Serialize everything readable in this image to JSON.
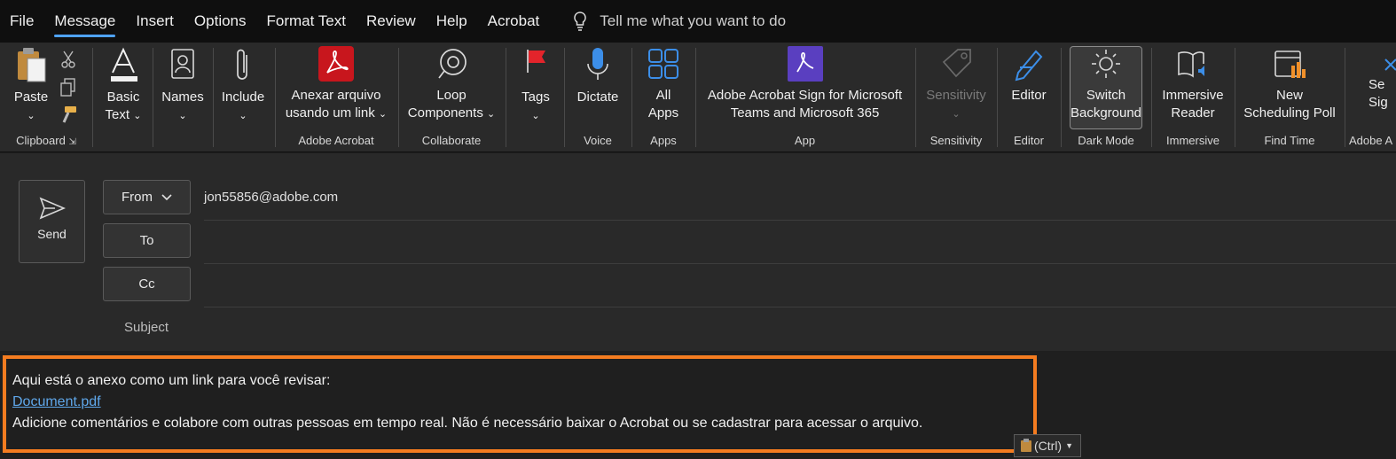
{
  "menu": {
    "items": [
      "File",
      "Message",
      "Insert",
      "Options",
      "Format Text",
      "Review",
      "Help",
      "Acrobat"
    ],
    "active": "Message",
    "tell_me": "Tell me what you want to do"
  },
  "ribbon": {
    "clipboard": {
      "paste": "Paste",
      "label": "Clipboard"
    },
    "basic_text": {
      "line1": "Basic",
      "line2": "Text"
    },
    "names": "Names",
    "include": "Include",
    "adobe_acrobat": {
      "line1": "Anexar arquivo",
      "line2": "usando um link",
      "label": "Adobe Acrobat"
    },
    "collaborate": {
      "line1": "Loop",
      "line2": "Components",
      "label": "Collaborate"
    },
    "tags": "Tags",
    "voice": {
      "button": "Dictate",
      "label": "Voice"
    },
    "apps": {
      "line1": "All",
      "line2": "Apps",
      "label": "Apps"
    },
    "app": {
      "line1": "Adobe Acrobat Sign for Microsoft",
      "line2": "Teams and Microsoft 365",
      "label": "App"
    },
    "sensitivity": {
      "button": "Sensitivity",
      "label": "Sensitivity"
    },
    "editor": {
      "button": "Editor",
      "label": "Editor"
    },
    "dark_mode": {
      "line1": "Switch",
      "line2": "Background",
      "label": "Dark Mode"
    },
    "immersive": {
      "line1": "Immersive",
      "line2": "Reader",
      "label": "Immersive"
    },
    "find_time": {
      "line1": "New",
      "line2": "Scheduling Poll",
      "label": "Find Time"
    },
    "adobe_sign": {
      "line1": "Se",
      "line2": "Sig",
      "label": "Adobe A"
    }
  },
  "compose": {
    "send": "Send",
    "from_label": "From",
    "from_value": "jon55856@adobe.com",
    "to_label": "To",
    "cc_label": "Cc",
    "subject_label": "Subject"
  },
  "message": {
    "line1": "Aqui está o anexo como um link para você revisar:",
    "link": "Document.pdf",
    "line3": "Adicione comentários e colabore com outras pessoas em tempo real. Não é necessário baixar o Acrobat ou se cadastrar para acessar o arquivo.",
    "paste_options": "(Ctrl)"
  },
  "colors": {
    "accent": "#4fa3ff",
    "highlight": "#f47c20",
    "link": "#5fa7ea",
    "acrobat_red": "#d7261f",
    "sign_purple": "#5a3fc0"
  }
}
